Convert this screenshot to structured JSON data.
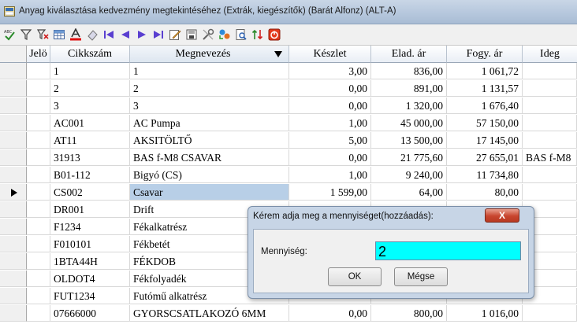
{
  "window": {
    "title": "Anyag kiválasztása kedvezmény megtekintéséhez (Extrák, kiegészítők) (Barát Alfonz) (ALT-A)"
  },
  "toolbar": {
    "icons": [
      "spellcheck-icon",
      "filter-icon",
      "clear-filter-icon",
      "grid-icon",
      "text-color-icon",
      "eraser-icon",
      "first-record-icon",
      "prev-record-icon",
      "next-record-icon",
      "last-record-icon",
      "edit-icon",
      "save-icon",
      "tools-icon",
      "transfer-icon",
      "preview-icon",
      "sort-icon",
      "exit-icon"
    ]
  },
  "grid": {
    "columns": [
      "Jelö",
      "Cikkszám",
      "Megnevezés",
      "Készlet",
      "Elad. ár",
      "Fogy. ár",
      "Ideg"
    ],
    "sorted_column": "Megnevezés",
    "rows": [
      {
        "code": "1",
        "name": "1",
        "stock": "3,00",
        "sale": "836,00",
        "cons": "1 061,72",
        "foreign": ""
      },
      {
        "code": "2",
        "name": "2",
        "stock": "0,00",
        "sale": "891,00",
        "cons": "1 131,57",
        "foreign": ""
      },
      {
        "code": "3",
        "name": "3",
        "stock": "0,00",
        "sale": "1 320,00",
        "cons": "1 676,40",
        "foreign": ""
      },
      {
        "code": "AC001",
        "name": "AC Pumpa",
        "stock": "1,00",
        "sale": "45 000,00",
        "cons": "57 150,00",
        "foreign": ""
      },
      {
        "code": "AT11",
        "name": "AKSITÖLTŐ",
        "stock": "5,00",
        "sale": "13 500,00",
        "cons": "17 145,00",
        "foreign": ""
      },
      {
        "code": "31913",
        "name": "BAS f-M8  CSAVAR",
        "stock": "0,00",
        "sale": "21 775,60",
        "cons": "27 655,01",
        "foreign": "BAS f-M8"
      },
      {
        "code": "B01-112",
        "name": "Bigyó (CS)",
        "stock": "1,00",
        "sale": "9 240,00",
        "cons": "11 734,80",
        "foreign": ""
      },
      {
        "code": "CS002",
        "name": "Csavar",
        "stock": "1 599,00",
        "sale": "64,00",
        "cons": "80,00",
        "foreign": ""
      },
      {
        "code": "DR001",
        "name": "Drift",
        "stock": "",
        "sale": "",
        "cons": "",
        "foreign": ""
      },
      {
        "code": "F1234",
        "name": "Fékalkatrész",
        "stock": "",
        "sale": "",
        "cons": "",
        "foreign": ""
      },
      {
        "code": "F010101",
        "name": "Fékbetét",
        "stock": "",
        "sale": "",
        "cons": "",
        "foreign": ""
      },
      {
        "code": "1BTA44H",
        "name": "FÉKDOB",
        "stock": "",
        "sale": "",
        "cons": "",
        "foreign": ""
      },
      {
        "code": "OLDOT4",
        "name": "Fékfolyadék",
        "stock": "",
        "sale": "",
        "cons": "",
        "foreign": ""
      },
      {
        "code": "FUT1234",
        "name": "Futómű alkatrész",
        "stock": "",
        "sale": "",
        "cons": "",
        "foreign": ""
      },
      {
        "code": "07666000",
        "name": "GYORSCSATLAKOZÓ 6MM",
        "stock": "0,00",
        "sale": "800,00",
        "cons": "1 016,00",
        "foreign": ""
      }
    ],
    "selected_row": 7
  },
  "dialog": {
    "title": "Kérem adja meg a mennyiséget(hozzáadás):",
    "close_label": "X",
    "quantity_label": "Mennyiség:",
    "quantity_value": "2",
    "ok_label": "OK",
    "cancel_label": "Mégse",
    "input_color": "#00ffff"
  }
}
